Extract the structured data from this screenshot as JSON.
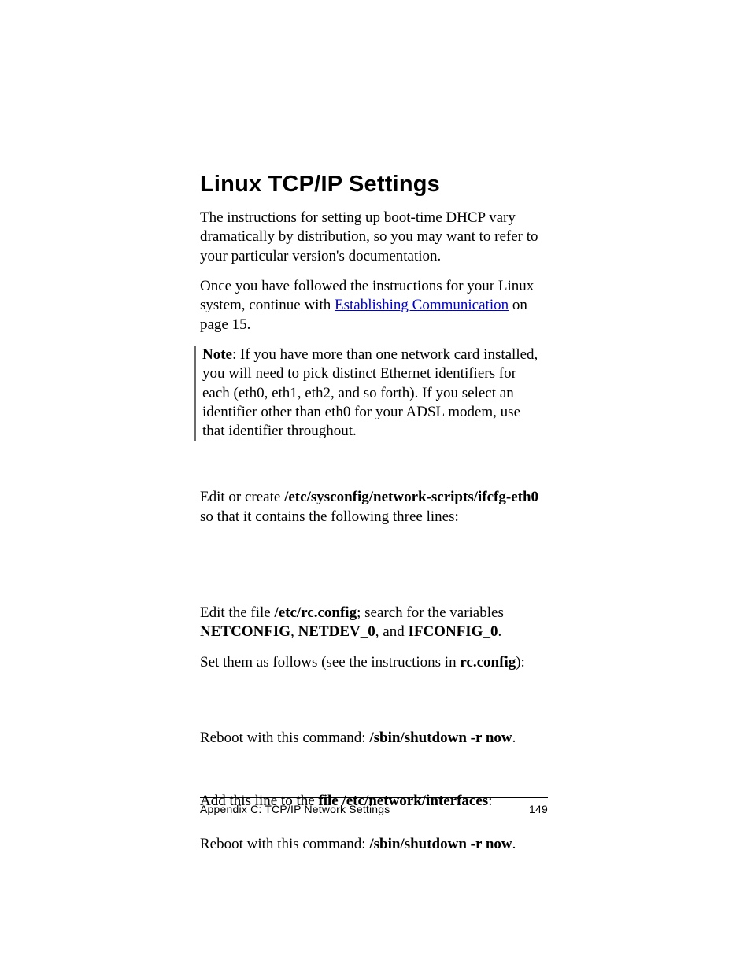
{
  "title": "Linux TCP/IP Settings",
  "p1": "The instructions for setting up boot-time DHCP vary dramatically by distribution, so you may want to refer to your particular version's documentation.",
  "p2_a": "Once you have followed the instructions for your Linux system, continue with ",
  "p2_link": "Establishing Communication",
  "p2_b": " on page 15.",
  "note_label": "Note",
  "note_body": ": If you have more than one network card installed, you will need to pick distinct Ethernet identifiers for each (eth0, eth1, eth2, and so forth). If you select an identifier other than eth0 for your ADSL modem, use that identifier throughout.",
  "edit1_a": "Edit or create ",
  "edit1_path": "/etc/sysconfig/network-scripts/ifcfg-eth0",
  "edit1_b": " so that it contains the following three lines:",
  "edit2_a": "Edit the file ",
  "edit2_path": "/etc/rc.config",
  "edit2_b": "; search for the variables ",
  "edit2_v1": "NETCONFIG",
  "edit2_sep1": ", ",
  "edit2_v2": "NETDEV_0",
  "edit2_sep2": ", and ",
  "edit2_v3": "IFCONFIG_0",
  "edit2_end": ".",
  "set_a": "Set them as follows (see the instructions in ",
  "set_b": "rc.config",
  "set_c": "):",
  "reboot_a": "Reboot with this command: ",
  "reboot_cmd": "/sbin/shutdown -r now",
  "reboot_end": ".",
  "add_a": "Add this line to the ",
  "add_b": "file /etc/network/interfaces",
  "add_c": ":",
  "footer_left": "Appendix C: TCP/IP Network Settings",
  "footer_right": "149"
}
